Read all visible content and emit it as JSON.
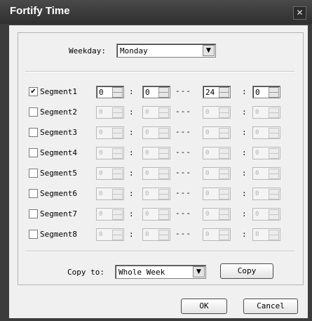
{
  "window": {
    "title": "Fortify Time",
    "close_glyph": "✕"
  },
  "weekday": {
    "label": "Weekday:",
    "value": "Monday"
  },
  "segments": [
    {
      "label": "Segment1",
      "checked": true,
      "start_h": "0",
      "start_m": "0",
      "end_h": "24",
      "end_m": "0"
    },
    {
      "label": "Segment2",
      "checked": false,
      "start_h": "0",
      "start_m": "0",
      "end_h": "0",
      "end_m": "0"
    },
    {
      "label": "Segment3",
      "checked": false,
      "start_h": "0",
      "start_m": "0",
      "end_h": "0",
      "end_m": "0"
    },
    {
      "label": "Segment4",
      "checked": false,
      "start_h": "0",
      "start_m": "0",
      "end_h": "0",
      "end_m": "0"
    },
    {
      "label": "Segment5",
      "checked": false,
      "start_h": "0",
      "start_m": "0",
      "end_h": "0",
      "end_m": "0"
    },
    {
      "label": "Segment6",
      "checked": false,
      "start_h": "0",
      "start_m": "0",
      "end_h": "0",
      "end_m": "0"
    },
    {
      "label": "Segment7",
      "checked": false,
      "start_h": "0",
      "start_m": "0",
      "end_h": "0",
      "end_m": "0"
    },
    {
      "label": "Segment8",
      "checked": false,
      "start_h": "0",
      "start_m": "0",
      "end_h": "0",
      "end_m": "0"
    }
  ],
  "separators": {
    "colon": ":",
    "dash": "---"
  },
  "copy_to": {
    "label": "Copy to:",
    "value": "Whole Week",
    "button": "Copy"
  },
  "footer": {
    "ok": "OK",
    "cancel": "Cancel"
  }
}
